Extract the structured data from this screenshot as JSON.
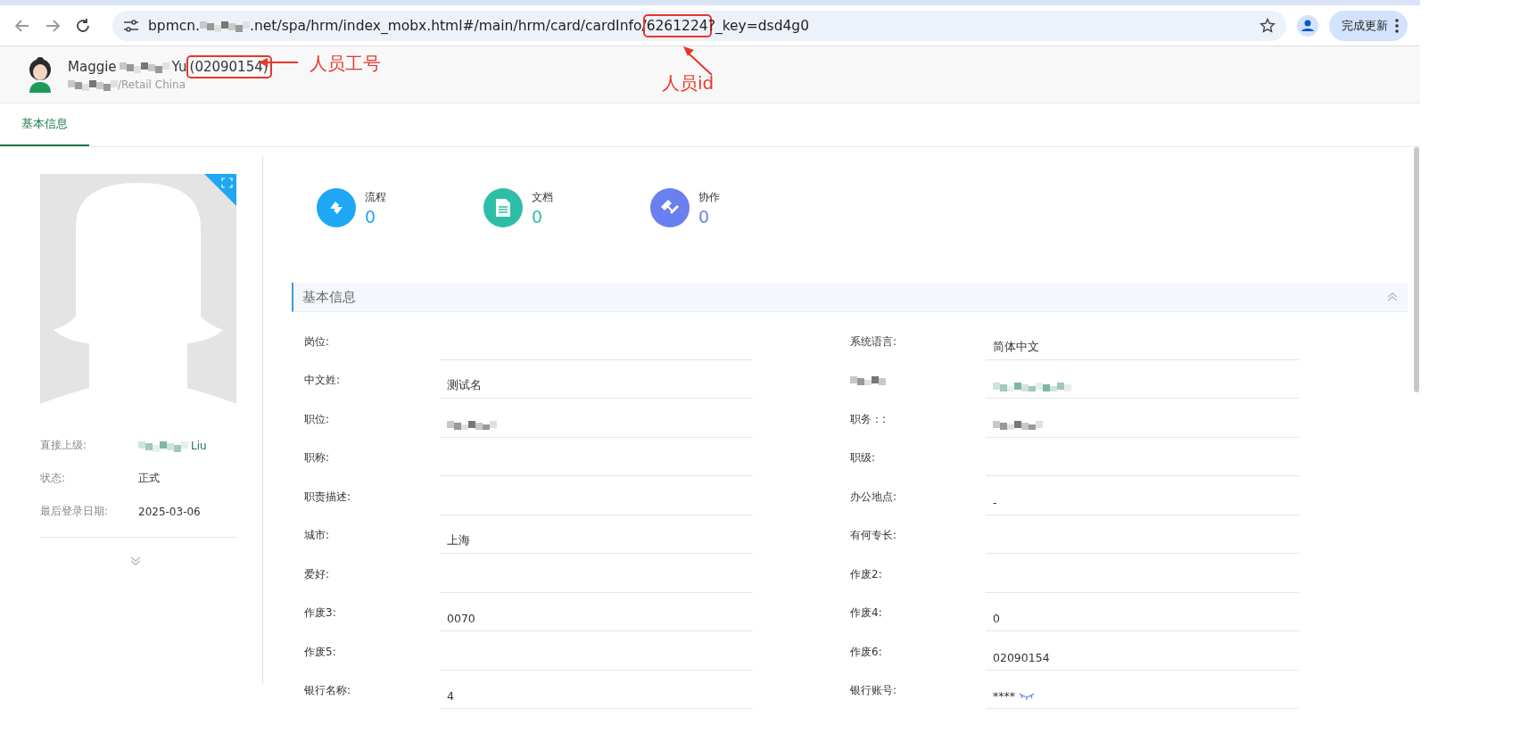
{
  "browser": {
    "url": [
      {
        "kind": "text",
        "text": "bpmcn."
      },
      {
        "kind": "redacted"
      },
      {
        "kind": "text",
        "text": ".net/spa/hrm/index_mobx.html#/main/hrm/card/cardInfo/"
      },
      {
        "kind": "text",
        "text": "6261224",
        "highlighted": true
      },
      {
        "kind": "text",
        "text": "?_key=dsd4g0"
      }
    ],
    "update_button": "完成更新"
  },
  "header": {
    "name": [
      {
        "kind": "text",
        "text": "Maggie"
      },
      {
        "kind": "redacted"
      },
      {
        "kind": "text",
        "text": "Yu"
      },
      {
        "kind": "text",
        "text": "(02090154)",
        "highlighted": true
      }
    ],
    "subtitle": [
      {
        "kind": "redacted"
      },
      {
        "kind": "text",
        "text": "/Retail China"
      }
    ]
  },
  "annotations": [
    {
      "kind": "employee_no",
      "label": "人员工号"
    },
    {
      "kind": "person_id",
      "label": "人员id"
    }
  ],
  "tabs": [
    {
      "label": "基本信息",
      "selected": true
    }
  ],
  "profile": {
    "info": [
      {
        "label": "直接上级:",
        "value": [
          {
            "kind": "redacted"
          },
          {
            "kind": "link",
            "text": "Liu"
          }
        ]
      },
      {
        "label": "状态:",
        "value": [
          {
            "kind": "text",
            "text": "正式"
          }
        ]
      },
      {
        "label": "最后登录日期:",
        "value": [
          {
            "kind": "text",
            "text": "2025-03-06"
          }
        ]
      }
    ]
  },
  "stats": [
    {
      "label": "流程",
      "count": "0",
      "color": "#1ea7f2",
      "kind": "flow"
    },
    {
      "label": "文档",
      "count": "0",
      "color": "#2ebea8",
      "kind": "doc"
    },
    {
      "label": "协作",
      "count": "0",
      "color": "#6a7ff0",
      "kind": "handshake"
    }
  ],
  "section": {
    "title": "基本信息",
    "expanded": true,
    "fields": [
      {
        "label": "岗位:"
      },
      {
        "label": "系统语言:",
        "value": "简体中文"
      },
      {
        "label": "中文姓:",
        "value": "测试名"
      },
      {
        "label_redacted": true,
        "value_redacted": true
      },
      {
        "label": "职位:",
        "value_redacted": true
      },
      {
        "label": "职务：:",
        "value_redacted": true
      },
      {
        "label": "职称:"
      },
      {
        "label": "职级:"
      },
      {
        "label": "职责描述:"
      },
      {
        "label": "办公地点:",
        "value": "-"
      },
      {
        "label": "城市:",
        "value": "上海"
      },
      {
        "label": "有何专长:"
      },
      {
        "label": "爱好:"
      },
      {
        "label": "作废2:"
      },
      {
        "label": "作废3:",
        "value": "0070"
      },
      {
        "label": "作废4:",
        "value": "0"
      },
      {
        "label": "作废5:"
      },
      {
        "label": "作废6:",
        "value": "02090154"
      },
      {
        "label": "银行名称:",
        "value": "4"
      },
      {
        "label": "银行账号:",
        "value": "****",
        "masked": true
      }
    ]
  }
}
